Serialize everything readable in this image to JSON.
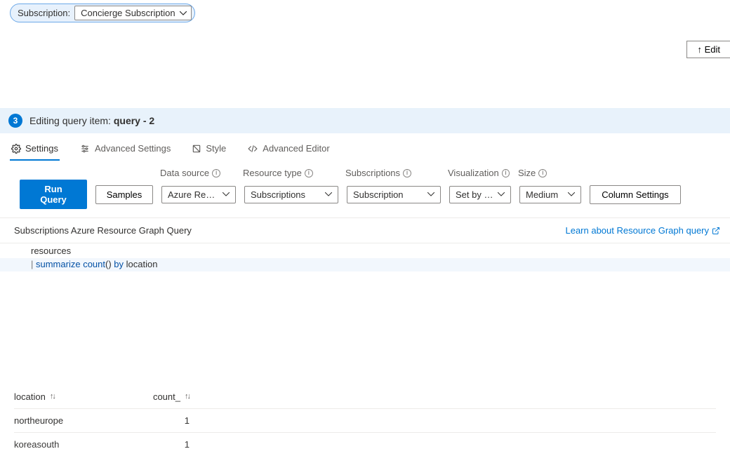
{
  "subscription": {
    "label": "Subscription:",
    "selected": "Concierge Subscription"
  },
  "editButton": "↑ Edit",
  "panel": {
    "step": "3",
    "titlePrefix": "Editing query item: ",
    "titleBold": "query - 2"
  },
  "tabs": {
    "settings": "Settings",
    "advancedSettings": "Advanced Settings",
    "style": "Style",
    "advancedEditor": "Advanced Editor"
  },
  "labels": {
    "dataSource": "Data source",
    "resourceType": "Resource type",
    "subscriptions": "Subscriptions",
    "visualization": "Visualization",
    "size": "Size"
  },
  "buttons": {
    "runQuery": "Run Query",
    "samples": "Samples",
    "columnSettings": "Column Settings"
  },
  "dropdowns": {
    "dataSource": "Azure Reso…",
    "resourceType": "Subscriptions",
    "subscriptions": "Subscription",
    "visualization": "Set by q…",
    "size": "Medium"
  },
  "subheader": {
    "title": "Subscriptions Azure Resource Graph Query",
    "link": "Learn about Resource Graph query"
  },
  "query": {
    "line1": "resources",
    "line2_prefix": "| ",
    "line2_summarize": "summarize",
    "line2_count": " count",
    "line2_parens": "() ",
    "line2_by": "by",
    "line2_suffix": " location"
  },
  "table": {
    "headers": {
      "location": "location",
      "count": "count_"
    },
    "rows": [
      {
        "location": "northeurope",
        "count": "1"
      },
      {
        "location": "koreasouth",
        "count": "1"
      }
    ]
  }
}
